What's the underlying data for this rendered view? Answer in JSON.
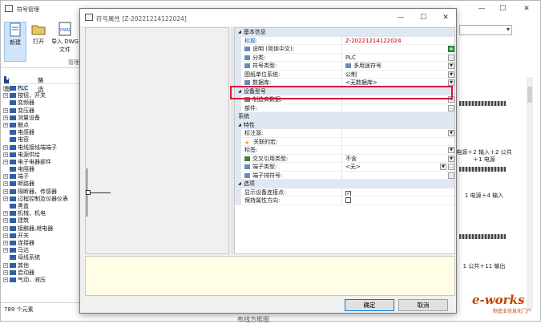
{
  "main": {
    "title": "符号管理",
    "ribbon": {
      "new": "新建",
      "open": "打开",
      "import": "导入 DWG",
      "import_line2": "文件",
      "group": "管理"
    },
    "toolbar": {
      "category": "分类",
      "filter": "筛选"
    },
    "tree": [
      {
        "label": "PLC",
        "selected": true
      },
      {
        "label": "按钮，开关"
      },
      {
        "label": "变频器",
        "leaf": true
      },
      {
        "label": "变压器"
      },
      {
        "label": "测量设备"
      },
      {
        "label": "触点"
      },
      {
        "label": "电感器",
        "leaf": true
      },
      {
        "label": "电容",
        "leaf": true
      },
      {
        "label": "电线接线端端子"
      },
      {
        "label": "电源供给"
      },
      {
        "label": "电子电器部件"
      },
      {
        "label": "电阻器",
        "leaf": true
      },
      {
        "label": "端子"
      },
      {
        "label": "断路器"
      },
      {
        "label": "隔断器，传感器"
      },
      {
        "label": "过程控制及仪器仪表"
      },
      {
        "label": "黑盒",
        "leaf": true
      },
      {
        "label": "机械，机电"
      },
      {
        "label": "建筑"
      },
      {
        "label": "接触器,继电器"
      },
      {
        "label": "开关"
      },
      {
        "label": "连接器"
      },
      {
        "label": "马达"
      },
      {
        "label": "母线系统",
        "leaf": true
      },
      {
        "label": "其他"
      },
      {
        "label": "启动器"
      },
      {
        "label": "气动，液压"
      }
    ],
    "status": "789 个元素",
    "preview_captions": [
      "电源＋2 输入＋2 公共＋1 电源",
      "1 电源＋4 输入",
      "1 公共＋11 输出"
    ],
    "bottom_text": "布线方框图",
    "watermark": "e-works",
    "watermark_sub": "制造业信息化门户"
  },
  "dialog": {
    "title": "符号属性 [Z-20221214122024]",
    "ok": "确定",
    "cancel": "取消",
    "categories": {
      "basic": "基本信息",
      "device": "设备型号",
      "system": "系统",
      "props": "特性",
      "options": "选项"
    },
    "rows": {
      "title_name": "标题:",
      "title_val": "Z-20221214122024",
      "desc_name": "说明 (简体中文):",
      "class_name": "分类:",
      "class_val": "PLC",
      "type_name": "符号类型:",
      "type_val": "多用途符号",
      "unit_name": "图纸单位系统:",
      "unit_val": "公制",
      "db_name": "数据库:",
      "db_val": "<无数据库>",
      "maker_name": "制造商数据:",
      "part_name": "部件:",
      "standard_name": "标注源:",
      "assoc_name": "关联的宏:",
      "mark_name": "标签:",
      "xref_name": "交叉引用类型:",
      "xref_val": "不含",
      "term_type_name": "端子类型:",
      "term_type_val": "<无>",
      "term_num_name": "端子排符号:",
      "show_conn_name": "显示设备连接点:",
      "keep_dir_name": "保持属性方向:"
    }
  }
}
